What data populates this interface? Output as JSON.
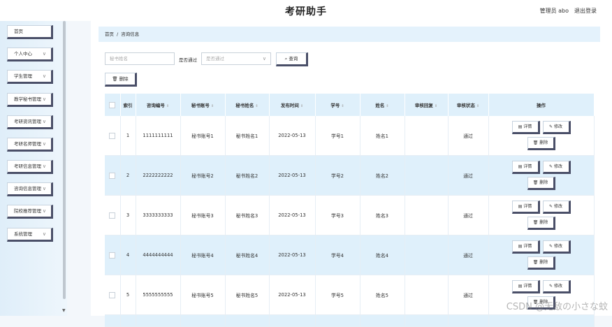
{
  "header": {
    "title": "考研助手",
    "user": "管理员 abo",
    "logout": "退出登录"
  },
  "sidebar": {
    "items": [
      {
        "label": "首页",
        "chevron": ""
      },
      {
        "label": "个人中心",
        "chevron": "∨"
      },
      {
        "label": "学生管理",
        "chevron": "∨"
      },
      {
        "label": "教学秘书管理",
        "chevron": "∨"
      },
      {
        "label": "考研资讯管理",
        "chevron": "∨"
      },
      {
        "label": "考研名师管理",
        "chevron": "∨"
      },
      {
        "label": "考研信息管理",
        "chevron": "∨"
      },
      {
        "label": "咨询信息管理",
        "chevron": "∨"
      },
      {
        "label": "院校推荐管理",
        "chevron": "∨"
      },
      {
        "label": "系统管理",
        "chevron": "∨"
      }
    ]
  },
  "breadcrumb": {
    "home": "首页",
    "separator": "/",
    "current": "咨询信息"
  },
  "search": {
    "name_placeholder": "秘书姓名",
    "filter_label": "是否通过",
    "filter_placeholder": "是否通过",
    "query_label": "查询",
    "batch_delete_label": "删除"
  },
  "table": {
    "columns": [
      "索引",
      "咨询编号",
      "秘书账号",
      "秘书姓名",
      "发布时间",
      "学号",
      "姓名",
      "审核回复",
      "审核状态",
      "操作"
    ],
    "rows": [
      {
        "index": "1",
        "code": "1111111111",
        "account": "秘书账号1",
        "secretary": "秘书姓名1",
        "time": "2022-05-13",
        "student_id": "学号1",
        "name": "姓名1",
        "reply": "",
        "status": "通过"
      },
      {
        "index": "2",
        "code": "2222222222",
        "account": "秘书账号2",
        "secretary": "秘书姓名2",
        "time": "2022-05-13",
        "student_id": "学号2",
        "name": "姓名2",
        "reply": "",
        "status": "通过"
      },
      {
        "index": "3",
        "code": "3333333333",
        "account": "秘书账号3",
        "secretary": "秘书姓名3",
        "time": "2022-05-13",
        "student_id": "学号3",
        "name": "姓名3",
        "reply": "",
        "status": "通过"
      },
      {
        "index": "4",
        "code": "4444444444",
        "account": "秘书账号4",
        "secretary": "秘书姓名4",
        "time": "2022-05-13",
        "student_id": "学号4",
        "name": "姓名4",
        "reply": "",
        "status": "通过"
      },
      {
        "index": "5",
        "code": "5555555555",
        "account": "秘书账号5",
        "secretary": "秘书姓名5",
        "time": "2022-05-13",
        "student_id": "学号5",
        "name": "姓名5",
        "reply": "",
        "status": "通过"
      }
    ],
    "actions": {
      "detail": "详情",
      "edit": "修改",
      "delete": "删除"
    }
  },
  "icons": {
    "detail": "file-icon",
    "edit": "pencil-icon",
    "delete": "trash-icon",
    "search": "search-icon"
  },
  "watermark": "CSDN @无敌の小さな蚊"
}
